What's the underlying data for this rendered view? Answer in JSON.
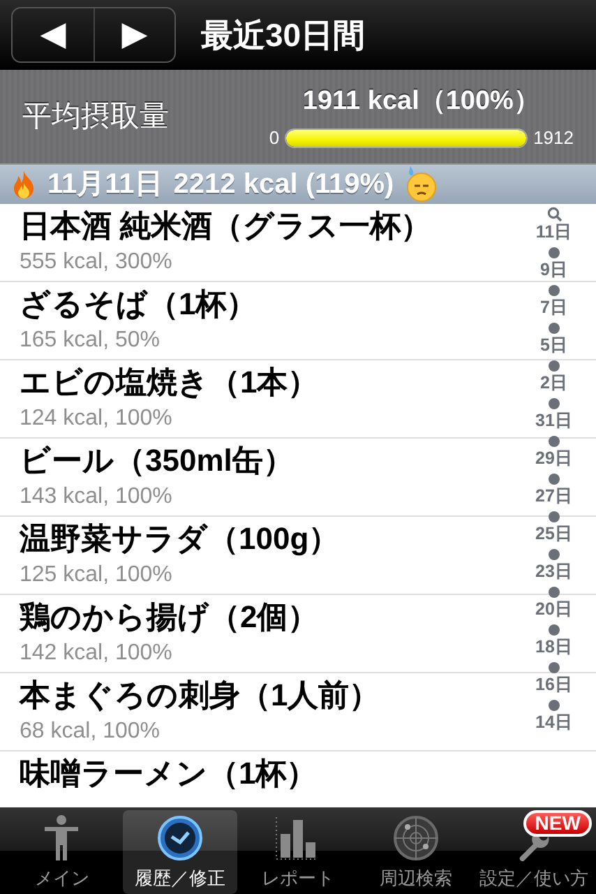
{
  "nav_bar": {
    "back_label": "◀",
    "forward_label": "▶",
    "title": "最近30日間"
  },
  "summary": {
    "label": "平均摂取量",
    "value": "1911 kcal（100%）",
    "min": "0",
    "max": "1912",
    "level": 1.0
  },
  "section": {
    "date": "11月11日",
    "total": "2212 kcal (119%)"
  },
  "entries": [
    {
      "name": "日本酒 純米酒（グラス一杯）",
      "detail": "555 kcal, 300%"
    },
    {
      "name": "ざるそば（1杯）",
      "detail": "165 kcal, 50%"
    },
    {
      "name": "エビの塩焼き（1本）",
      "detail": "124 kcal, 100%"
    },
    {
      "name": "ビール（350ml缶）",
      "detail": "143 kcal, 100%"
    },
    {
      "name": "温野菜サラダ（100g）",
      "detail": "125 kcal, 100%"
    },
    {
      "name": "鶏のから揚げ（2個）",
      "detail": "142 kcal, 100%"
    },
    {
      "name": "本まぐろの刺身（1人前）",
      "detail": "68 kcal, 100%"
    },
    {
      "name": "味噌ラーメン（1杯）"
    }
  ],
  "index": [
    "11日",
    "9日",
    "7日",
    "5日",
    "2日",
    "31日",
    "29日",
    "27日",
    "25日",
    "23日",
    "20日",
    "18日",
    "16日",
    "14日"
  ],
  "tab_bar": [
    {
      "kind": "person",
      "label": "メイン",
      "selected": false
    },
    {
      "kind": "clock",
      "label": "履歴／修正",
      "selected": true
    },
    {
      "kind": "chart",
      "label": "レポート",
      "selected": false
    },
    {
      "kind": "radar",
      "label": "周辺検索",
      "selected": false
    },
    {
      "kind": "wrench",
      "label": "設定／使い方",
      "selected": false,
      "badge": "NEW"
    }
  ]
}
